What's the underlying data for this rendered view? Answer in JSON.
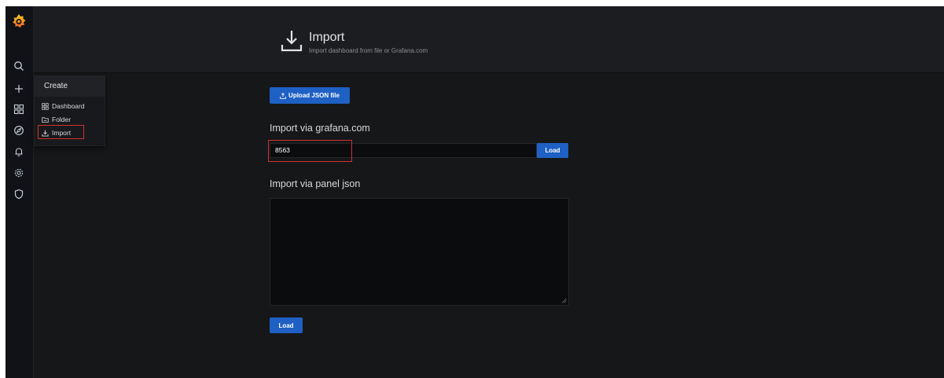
{
  "header": {
    "title": "Import",
    "subtitle": "Import dashboard from file or Grafana.com"
  },
  "sidebar": {
    "icons": [
      "grafana-logo",
      "search-icon",
      "plus-icon",
      "dashboards-icon",
      "explore-icon",
      "alerting-icon",
      "settings-icon",
      "shield-icon"
    ]
  },
  "create_menu": {
    "title": "Create",
    "items": [
      {
        "label": "Dashboard",
        "icon": "dashboards-icon"
      },
      {
        "label": "Folder",
        "icon": "folder-icon"
      },
      {
        "label": "Import",
        "icon": "import-icon"
      }
    ]
  },
  "main": {
    "upload_label": "Upload JSON file",
    "grafana_section": "Import via grafana.com",
    "grafana_id_value": "8563",
    "load_label": "Load",
    "panel_json_section": "Import via panel json",
    "panel_json_value": "",
    "load_bottom_label": "Load"
  },
  "colors": {
    "accent": "#1f60c4",
    "highlight": "#d03030",
    "background": "#161719"
  }
}
